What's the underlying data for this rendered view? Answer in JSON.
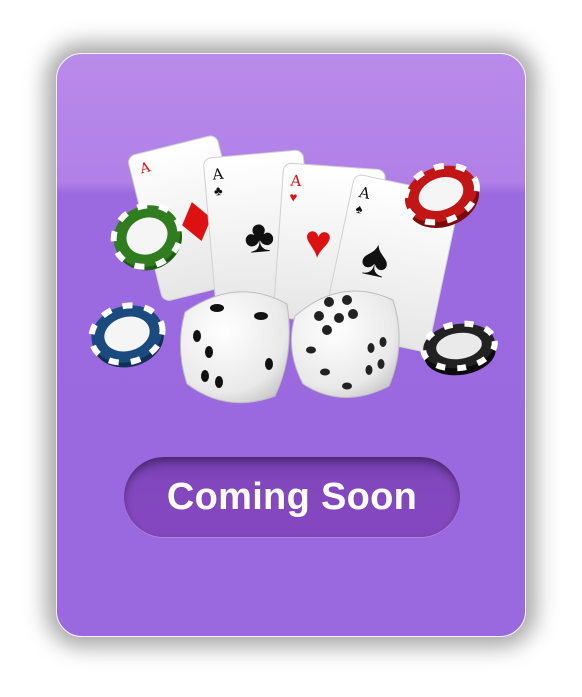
{
  "card": {
    "cta_label": "Coming Soon"
  },
  "illustration": {
    "cards": [
      {
        "rank": "A",
        "suit": "diamonds"
      },
      {
        "rank": "A",
        "suit": "clubs"
      },
      {
        "rank": "A",
        "suit": "hearts"
      },
      {
        "rank": "A",
        "suit": "spades"
      }
    ],
    "chips": [
      "green",
      "blue",
      "red",
      "black"
    ],
    "dice": 2
  },
  "colors": {
    "card_top": "#b98bea",
    "card_bottom": "#9a68df",
    "button": "#8547c0",
    "button_text": "#ffffff"
  }
}
